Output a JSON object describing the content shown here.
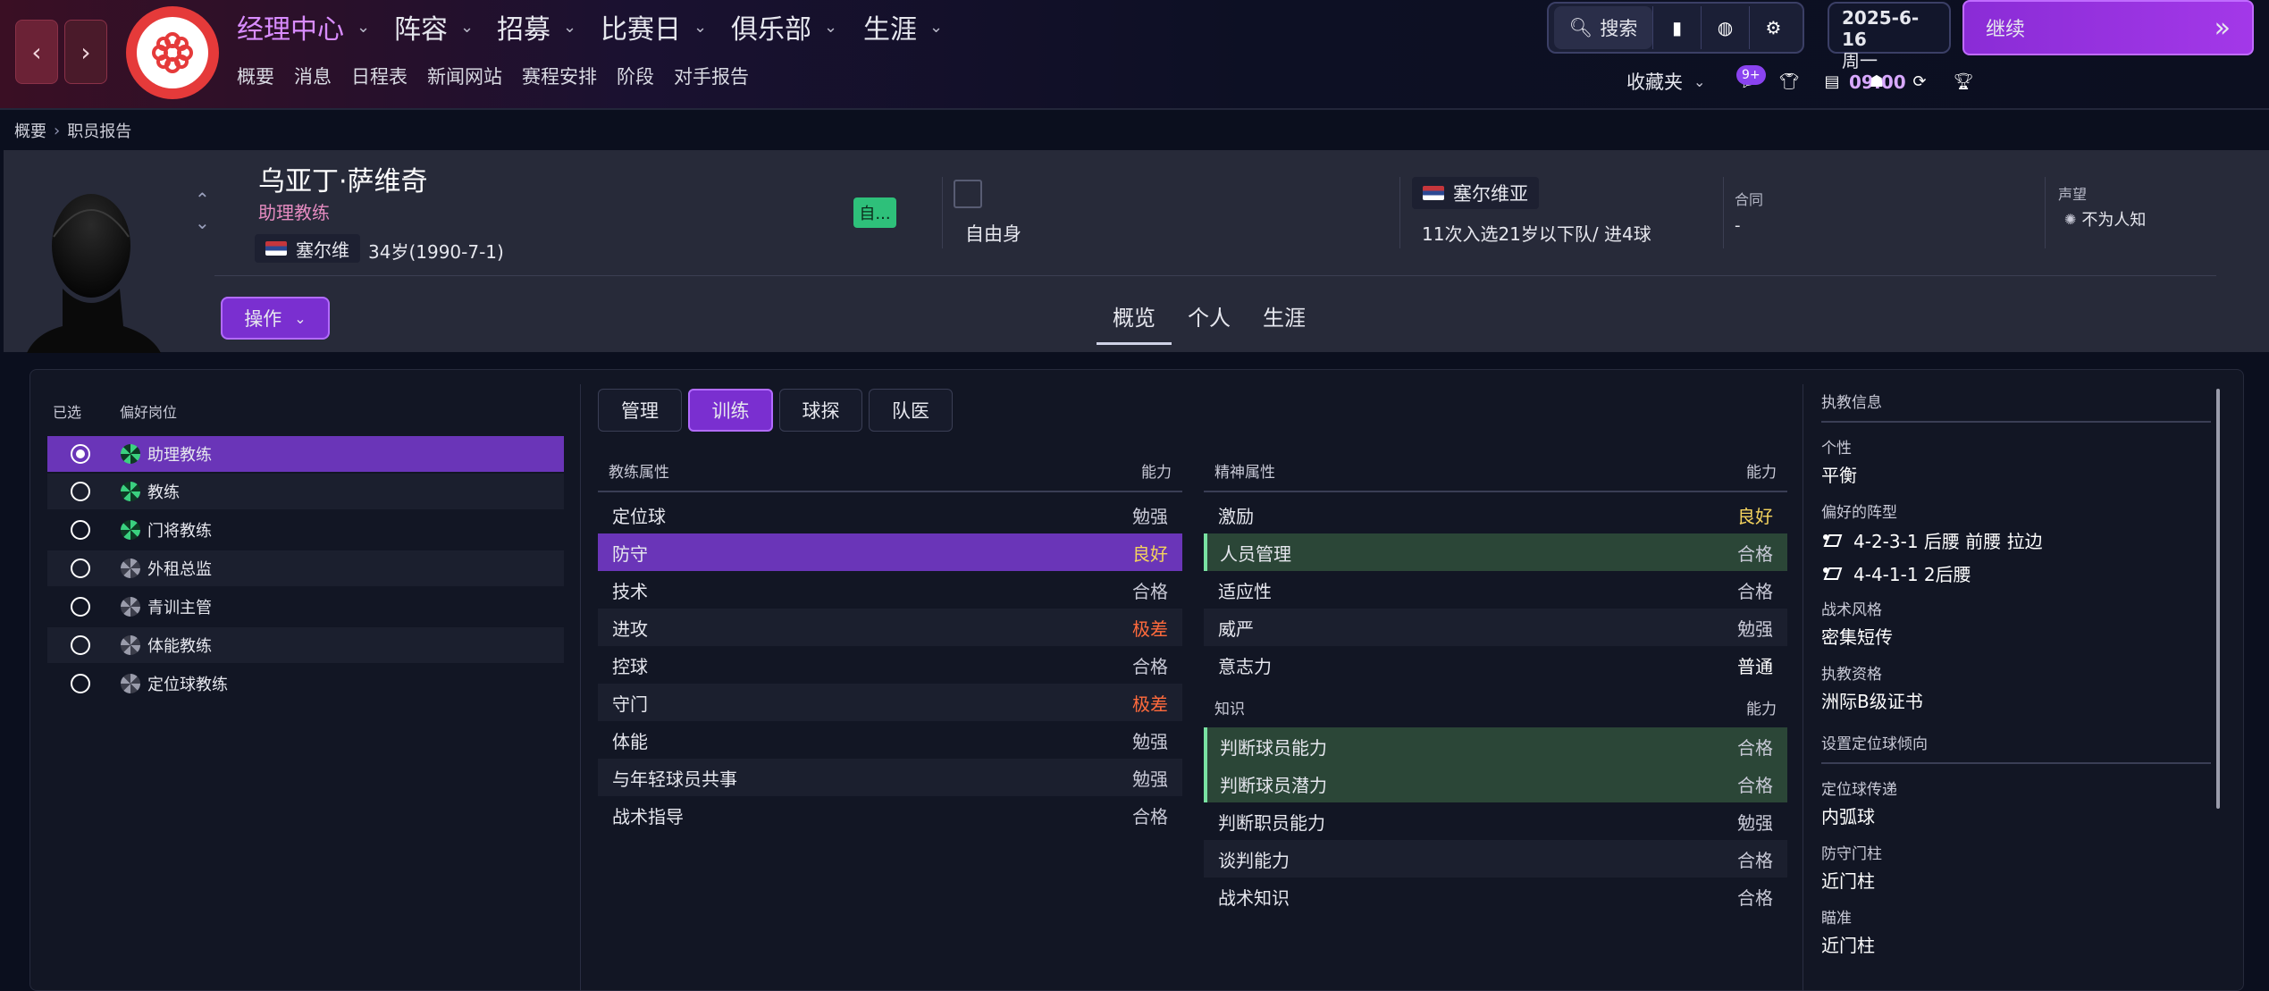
{
  "nav": {
    "items": [
      {
        "label": "经理中心",
        "active": true
      },
      {
        "label": "阵容"
      },
      {
        "label": "招募"
      },
      {
        "label": "比赛日"
      },
      {
        "label": "俱乐部"
      },
      {
        "label": "生涯"
      }
    ],
    "sub_items": [
      "概要",
      "消息",
      "日程表",
      "新闻网站",
      "赛程安排",
      "阶段",
      "对手报告"
    ],
    "search_label": "搜索",
    "date": "2025-6-16",
    "weekday": "周一",
    "time": "09:00",
    "continue_label": "继续",
    "favorites_label": "收藏夹",
    "notification_badge": "9+",
    "accent_color": "#a338e8"
  },
  "breadcrumb": [
    "概要",
    "职员报告"
  ],
  "staff": {
    "name": "乌亚丁·萨维奇",
    "role": "助理教练",
    "nationality_short": "塞尔维",
    "age": "34岁(1990-7-1)",
    "status_pill": "自...",
    "contract_status": "自由身",
    "nation_full": "塞尔维亚",
    "intl_caps": "11次入选21岁以下队/ 进4球",
    "contract_title": "合同",
    "contract_value": "-",
    "reputation_title": "声望",
    "reputation_value": "不为人知",
    "action_label": "操作",
    "tabs": [
      "概览",
      "个人",
      "生涯"
    ]
  },
  "roles": {
    "header_selected": "已选",
    "header_role": "偏好岗位",
    "items": [
      {
        "label": "助理教练",
        "selected": true,
        "rating_color": "green"
      },
      {
        "label": "教练",
        "selected": false,
        "rating_color": "green"
      },
      {
        "label": "门将教练",
        "selected": false,
        "rating_color": "green"
      },
      {
        "label": "外租总监",
        "selected": false,
        "rating_color": "grey"
      },
      {
        "label": "青训主管",
        "selected": false,
        "rating_color": "grey"
      },
      {
        "label": "体能教练",
        "selected": false,
        "rating_color": "grey"
      },
      {
        "label": "定位球教练",
        "selected": false,
        "rating_color": "grey"
      }
    ]
  },
  "attr_tabs": [
    {
      "label": "管理"
    },
    {
      "label": "训练",
      "active": true
    },
    {
      "label": "球探"
    },
    {
      "label": "队医"
    }
  ],
  "coaching": {
    "header": "教练属性",
    "ability_header": "能力",
    "rows": [
      {
        "label": "定位球",
        "value": "勉强"
      },
      {
        "label": "防守",
        "value": "良好"
      },
      {
        "label": "技术",
        "value": "合格"
      },
      {
        "label": "进攻",
        "value": "极差"
      },
      {
        "label": "控球",
        "value": "合格"
      },
      {
        "label": "守门",
        "value": "极差"
      },
      {
        "label": "体能",
        "value": "勉强"
      },
      {
        "label": "与年轻球员共事",
        "value": "勉强"
      },
      {
        "label": "战术指导",
        "value": "合格"
      }
    ]
  },
  "mental": {
    "header": "精神属性",
    "ability_header": "能力",
    "rows": [
      {
        "label": "激励",
        "value": "良好"
      },
      {
        "label": "人员管理",
        "value": "合格"
      },
      {
        "label": "适应性",
        "value": "合格"
      },
      {
        "label": "威严",
        "value": "勉强"
      },
      {
        "label": "意志力",
        "value": "普通"
      }
    ]
  },
  "knowledge": {
    "header": "知识",
    "ability_header": "能力",
    "rows": [
      {
        "label": "判断球员能力",
        "value": "合格"
      },
      {
        "label": "判断球员潜力",
        "value": "合格"
      },
      {
        "label": "判断职员能力",
        "value": "勉强"
      },
      {
        "label": "谈判能力",
        "value": "合格"
      },
      {
        "label": "战术知识",
        "value": "合格"
      }
    ]
  },
  "coaching_info": {
    "title": "执教信息",
    "personality_label": "个性",
    "personality": "平衡",
    "formation_label": "偏好的阵型",
    "formations": [
      "4-2-3-1 后腰 前腰 拉边",
      "4-4-1-1 2后腰"
    ],
    "style_label": "战术风格",
    "style": "密集短传",
    "badge_label": "执教资格",
    "badge": "洲际B级证书",
    "setpiece_title": "设置定位球倾向",
    "setpiece_delivery_label": "定位球传递",
    "setpiece_delivery": "内弧球",
    "defend_post_label": "防守门柱",
    "defend_post": "近门柱",
    "aim_label": "瞄准",
    "aim": "近门柱"
  }
}
